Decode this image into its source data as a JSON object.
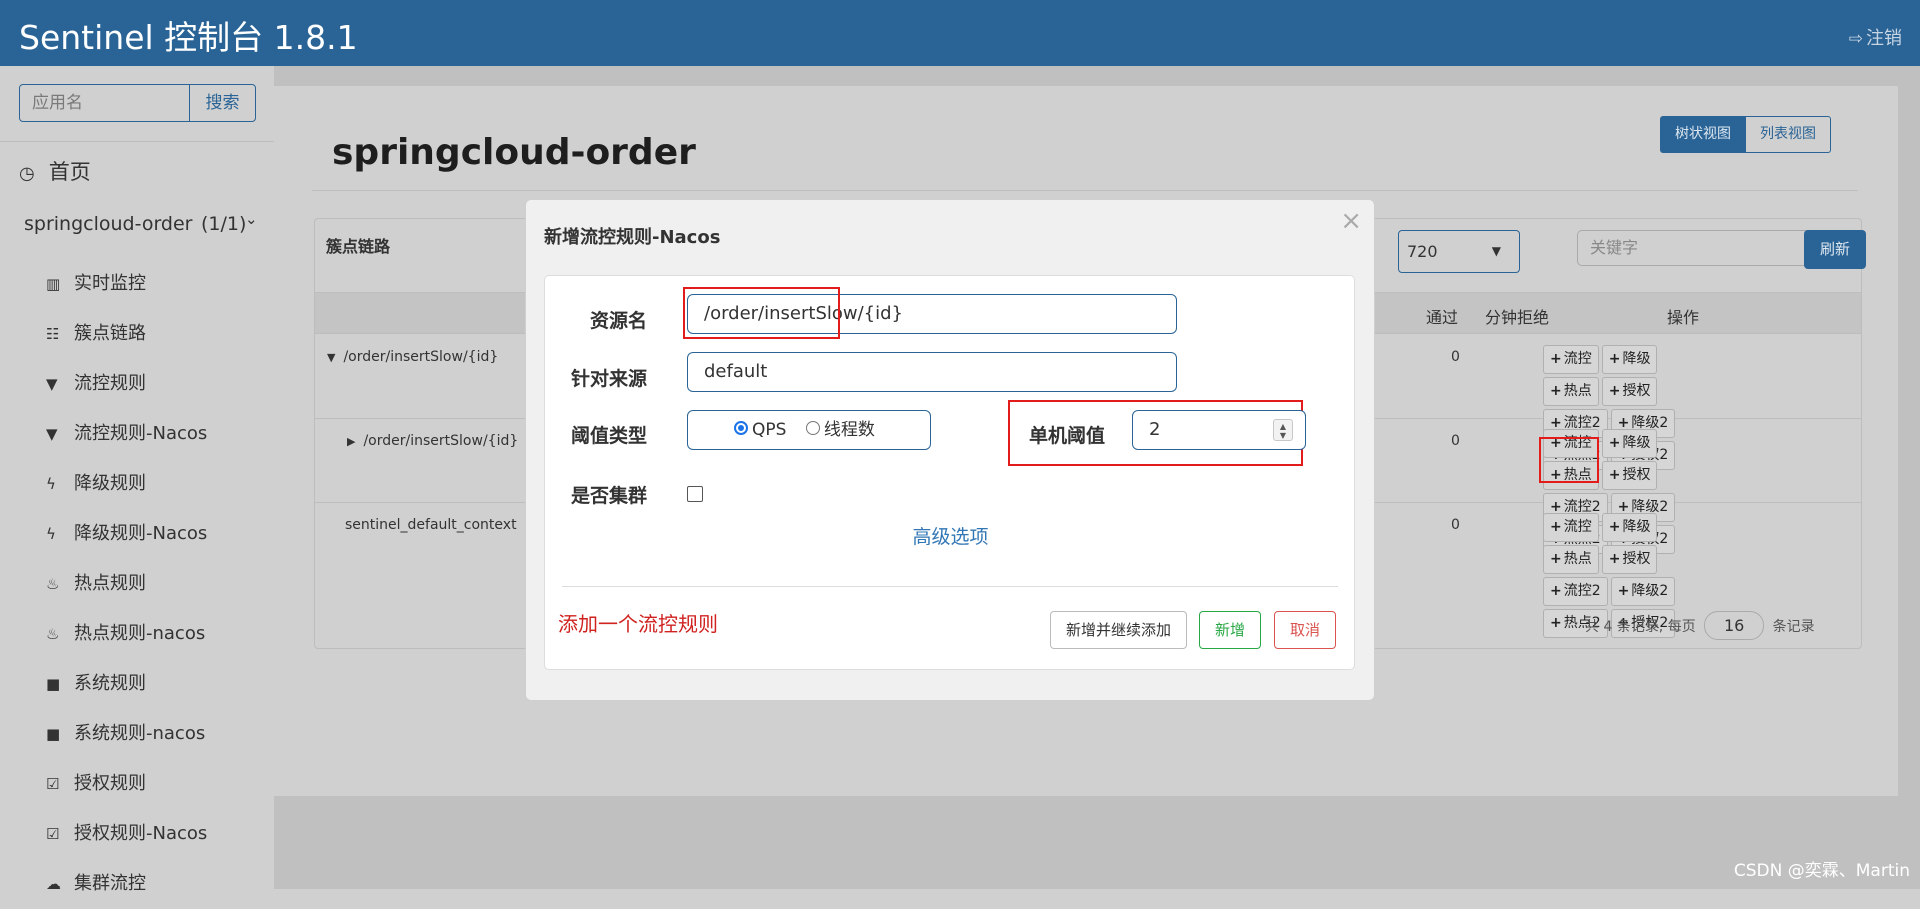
{
  "header": {
    "brand": "Sentinel 控制台 1.8.1",
    "logout": "注销"
  },
  "sidebar": {
    "search_placeholder": "应用名",
    "search_button": "搜索",
    "home": "首页",
    "app_name": "springcloud-order",
    "app_count": "(1/1)",
    "menu": [
      {
        "label": "实时监控",
        "icon": "bar-chart-icon"
      },
      {
        "label": "簇点链路",
        "icon": "list-icon"
      },
      {
        "label": "流控规则",
        "icon": "filter-icon"
      },
      {
        "label": "流控规则-Nacos",
        "icon": "filter-icon"
      },
      {
        "label": "降级规则",
        "icon": "bolt-icon"
      },
      {
        "label": "降级规则-Nacos",
        "icon": "bolt-icon"
      },
      {
        "label": "热点规则",
        "icon": "fire-icon"
      },
      {
        "label": "热点规则-nacos",
        "icon": "fire-icon"
      },
      {
        "label": "系统规则",
        "icon": "lock-icon"
      },
      {
        "label": "系统规则-nacos",
        "icon": "lock-icon"
      },
      {
        "label": "授权规则",
        "icon": "check-square-icon"
      },
      {
        "label": "授权规则-Nacos",
        "icon": "check-square-icon"
      },
      {
        "label": "集群流控",
        "icon": "cloud-icon"
      }
    ]
  },
  "main": {
    "title": "springcloud-order",
    "view_tree": "树状视图",
    "view_list": "列表视图",
    "table_title": "簇点链路",
    "ip_select": "720",
    "keyword_placeholder": "关键字",
    "refresh": "刷新",
    "headers": {
      "pass": "通过",
      "reject": "分钟拒绝",
      "ops": "操作"
    },
    "rows": [
      {
        "resource": "/order/insertSlow/{id}",
        "reject": "0",
        "expand": "▼"
      },
      {
        "resource": "/order/insertSlow/{id}",
        "reject": "0",
        "expand": "▶"
      },
      {
        "resource": "sentinel_default_context",
        "reject": "0",
        "expand": ""
      }
    ],
    "ops": [
      "流控",
      "降级",
      "热点",
      "授权",
      "流控2",
      "降级2",
      "热点2",
      "授权2"
    ],
    "pager_prefix": "共 4 条记录, 每页",
    "page_size": "16",
    "pager_suffix": "条记录"
  },
  "modal": {
    "title": "新增流控规则-Nacos",
    "close": "×",
    "resource_label": "资源名",
    "resource_value": "/order/insertSlow/{id}",
    "origin_label": "针对来源",
    "origin_value": "default",
    "threshold_type_label": "阈值类型",
    "qps": "QPS",
    "threads": "线程数",
    "threshold_label": "单机阈值",
    "threshold_value": "2",
    "cluster_label": "是否集群",
    "advanced": "高级选项",
    "annotation": "添加一个流控规则",
    "btn_add_continue": "新增并继续添加",
    "btn_add": "新增",
    "btn_cancel": "取消"
  },
  "watermark": "CSDN @奕霖、Martin",
  "colors": {
    "primary": "#2a6496",
    "success": "#28a745",
    "danger": "#d9534f",
    "highlight": "#e21b1b"
  }
}
